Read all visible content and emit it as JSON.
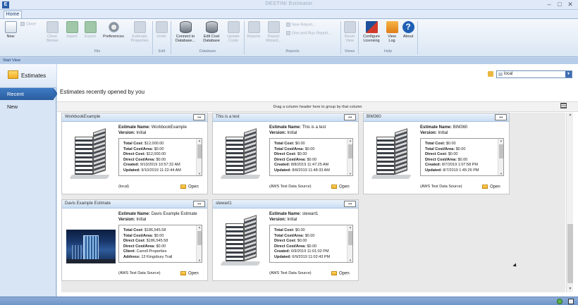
{
  "window": {
    "title": "DESTINI Estimator"
  },
  "ribbon": {
    "tab": "Home",
    "buttons": {
      "new": "New",
      "close": "Close",
      "close_stories": "Close\nStories",
      "import": "Import",
      "export": "Export",
      "preferences": "Preferences",
      "estimate_properties": "Estimate\nProperties",
      "undo": "Undo",
      "connect_db": "Connect to\nDatabase...",
      "edit_cost_db": "Edit Cost\nDatabase",
      "update_costs": "Update\nCosts",
      "reports": "Reports",
      "report_wizard": "Report\nWizard...",
      "reset_view": "Reset\nView",
      "configure_licensing": "Configure\nLicensing",
      "view_log": "View\nLog",
      "about": "About"
    },
    "small_items": {
      "new_report": "New Report...",
      "one_and_run": "One-and-Run Report..."
    },
    "groups": {
      "file": "File",
      "edit": "Edit",
      "database": "Database",
      "reports": "Reports",
      "views": "Views",
      "help": "Help"
    }
  },
  "start_view": "Start View",
  "sidebar": {
    "estimates": "Estimates",
    "recent": "Recent",
    "new": "New"
  },
  "main": {
    "heading": "Estimates recently opened by you",
    "location": "local",
    "group_hint": "Drag a column header here to group by that column"
  },
  "cards": [
    {
      "name": "WorkbookExample",
      "estimate_name_label": "Estimate Name:",
      "estimate_name": "WorkbookExample",
      "version_label": "Version:",
      "version": "Initial",
      "lines": [
        [
          "Total Cost:",
          "$12,000.00"
        ],
        [
          "Total Cost/Area:",
          "$0.00"
        ],
        [
          "Direct Cost:",
          "$12,000.00"
        ],
        [
          "Direct Cost/Area:",
          "$0.00"
        ],
        [
          "Created:",
          "9/10/2019 10:57:32 AM"
        ],
        [
          "Updated:",
          "9/10/2019 11:22:44 AM"
        ]
      ],
      "source": "(local)",
      "open": "Open"
    },
    {
      "name": "This is a test",
      "estimate_name_label": "Estimate Name:",
      "estimate_name": "This is a test",
      "version_label": "Version:",
      "version": "Initial",
      "lines": [
        [
          "Total Cost:",
          "$0.00"
        ],
        [
          "Total Cost/Area:",
          "$0.00"
        ],
        [
          "Direct Cost:",
          "$0.00"
        ],
        [
          "Direct Cost/Area:",
          "$0.00"
        ],
        [
          "Created:",
          "8/8/2019 11:47:25 AM"
        ],
        [
          "Updated:",
          "8/8/2019 11:48:33 AM"
        ]
      ],
      "source": "(AWS Test Data Source)",
      "open": "Open"
    },
    {
      "name": "BIM360",
      "estimate_name_label": "Estimate Name:",
      "estimate_name": "BIM360",
      "version_label": "Version:",
      "version": "Initial",
      "lines": [
        [
          "Total Cost:",
          "$0.00"
        ],
        [
          "Total Cost/Area:",
          "$0.00"
        ],
        [
          "Direct Cost:",
          "$0.00"
        ],
        [
          "Direct Cost/Area:",
          "$0.00"
        ],
        [
          "Created:",
          "8/7/2019 1:07:58 PM"
        ],
        [
          "Updated:",
          "8/7/2019 1:45:26 PM"
        ]
      ],
      "source": "(AWS Test Data Source)",
      "open": "Open"
    },
    {
      "name": "Davis Example Estimate",
      "estimate_name_label": "Estimate Name:",
      "estimate_name": "Davis Example Estimate",
      "version_label": "Version:",
      "version": "Initial",
      "lines": [
        [
          "Total Cost:",
          "$186,545.58"
        ],
        [
          "Total Cost/Area:",
          "$0.00"
        ],
        [
          "Direct Cost:",
          "$186,545.58"
        ],
        [
          "Direct Cost/Area:",
          "$0.00"
        ],
        [
          "Client:",
          "Carroll Properties"
        ],
        [
          "Address:",
          "13 Kingsbury Trail"
        ]
      ],
      "source": "(AWS Test Data Source)",
      "open": "Open"
    },
    {
      "name": "stewart1",
      "estimate_name_label": "Estimate Name:",
      "estimate_name": "stewart1",
      "version_label": "Version:",
      "version": "Initial",
      "lines": [
        [
          "Total Cost:",
          "$0.00"
        ],
        [
          "Total Cost/Area:",
          "$0.00"
        ],
        [
          "Direct Cost:",
          "$0.00"
        ],
        [
          "Direct Cost/Area:",
          "$0.00"
        ],
        [
          "Created:",
          "6/9/2019 11:01:02 PM"
        ],
        [
          "Updated:",
          "6/9/2019 11:02:43 PM"
        ]
      ],
      "source": "(AWS Test Data Source)",
      "open": "Open"
    }
  ]
}
